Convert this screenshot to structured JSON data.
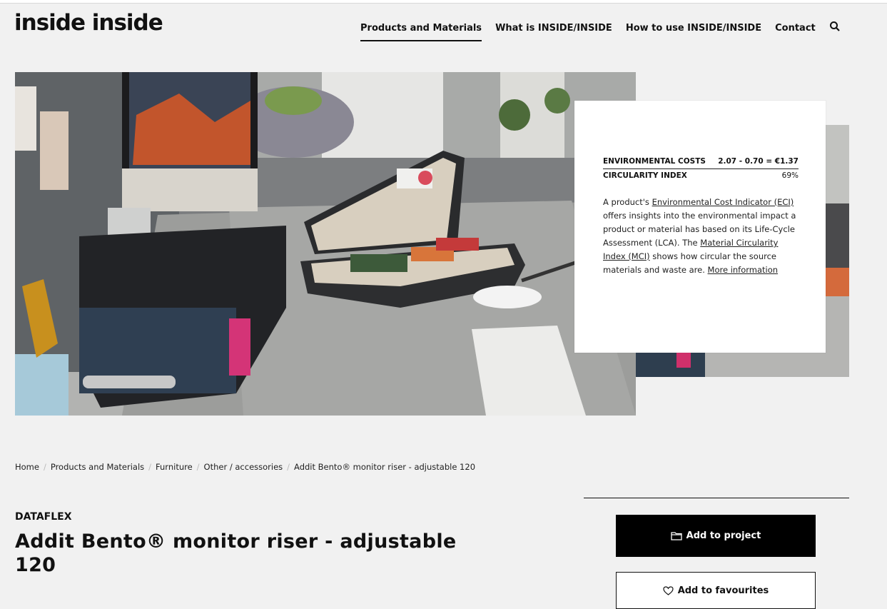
{
  "header": {
    "logo": "inside inside",
    "nav": [
      "Products and Materials",
      "What is INSIDE/INSIDE",
      "How to use INSIDE/INSIDE",
      "Contact"
    ],
    "active_nav": "Products and Materials",
    "search_icon": "search-icon"
  },
  "info_card": {
    "env_costs_label": "ENVIRONMENTAL COSTS",
    "env_costs_value": "2.07 - 0.70 = €1.37",
    "circularity_label": "CIRCULARITY INDEX",
    "circularity_value": "69%",
    "text": {
      "t1": "A product's ",
      "l1": "Environmental Cost Indicator (ECI)",
      "t2": " offers insights into the environmental impact a product or material has based on its Life-Cycle Assessment (LCA). The ",
      "l2": "Material Circularity Index (MCI)",
      "t3": " shows how circular the source materials and waste are. ",
      "l3": "More information"
    }
  },
  "breadcrumb": [
    "Home",
    "Products and Materials",
    "Furniture",
    "Other / accessories",
    "Addit Bento® monitor riser - adjustable 120"
  ],
  "product": {
    "brand": "DATAFLEX",
    "title": "Addit Bento® monitor riser - adjustable 120"
  },
  "actions": {
    "add_to_project": "Add to project",
    "add_to_project_icon": "folder-icon",
    "add_to_favourites": "Add to favourites",
    "add_to_favourites_icon": "heart-icon"
  }
}
